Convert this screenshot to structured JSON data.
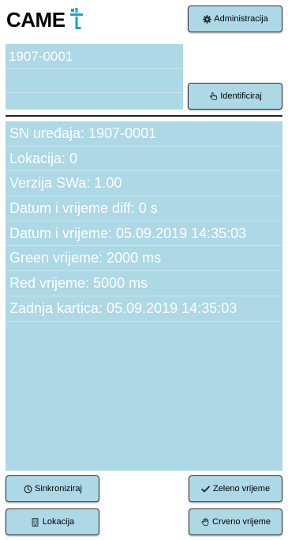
{
  "logo": {
    "text": "CAME",
    "mark_color": "#1aa0d8"
  },
  "buttons": {
    "administration": {
      "label": "Administracija",
      "icon": "gear-icon"
    },
    "identify": {
      "label": "Identificiraj",
      "icon": "hand-pointer-icon"
    },
    "synchronize": {
      "label": "Sinkroniziraj",
      "icon": "clock-icon"
    },
    "green_time": {
      "label": "Zeleno vrijeme",
      "icon": "check-icon"
    },
    "location": {
      "label": "Lokacija",
      "icon": "building-icon"
    },
    "red_time": {
      "label": "Crveno vrijeme",
      "icon": "hand-stop-icon"
    }
  },
  "devices": [
    {
      "label": "1907-0001"
    },
    {
      "label": ""
    }
  ],
  "info_rows": [
    "SN uređaja: 1907-0001",
    "Lokacija: 0",
    "Verzija SWa: 1.00",
    "Datum i vrijeme diff: 0 s",
    "Datum i vrijeme: 05.09.2019 14:35:03",
    "Green vrijeme: 2000 ms",
    "Red vrijeme: 5000 ms",
    "Zadnja kartica: 05.09.2019 14:35:03"
  ],
  "colors": {
    "panel": "#add8e6",
    "panel_text": "#ffffff",
    "separator": "#222222"
  }
}
